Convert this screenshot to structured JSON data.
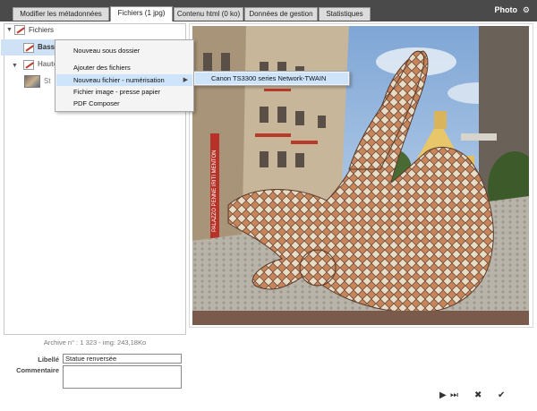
{
  "tabs": [
    {
      "label": "Modifier les métadonnées",
      "active": false
    },
    {
      "label": "Fichiers (1 jpg)",
      "active": true
    },
    {
      "label": "Contenu html (0 ko)",
      "active": false
    },
    {
      "label": "Données de gestion",
      "active": false
    },
    {
      "label": "Statistiques",
      "active": false
    }
  ],
  "header": {
    "title": "Photo",
    "gear_icon": "gear-icon"
  },
  "tree": {
    "root_label": "Fichiers",
    "items": [
      {
        "label": "Bass",
        "expanded": false,
        "selected": true
      },
      {
        "label": "Haute",
        "expanded": true
      },
      {
        "label": "St"
      }
    ]
  },
  "context_menu": {
    "items": [
      {
        "label": "Nouveau sous dossier"
      },
      {
        "label": "Ajouter des fichiers"
      },
      {
        "label": "Nouveau fichier - numérisation",
        "highlighted": true,
        "has_submenu": true
      },
      {
        "label": "Fichier image - presse papier"
      },
      {
        "label": "PDF Composer"
      }
    ],
    "submenu": {
      "items": [
        {
          "label": "Canon TS3300 series Network-TWAIN",
          "highlighted": true
        }
      ]
    }
  },
  "details": {
    "archive_info": "Archive n° : 1 323 - img: 243,18Ko",
    "libelle_label": "Libellé",
    "libelle_value": "Statue renversée",
    "commentaire_label": "Commentaire",
    "commentaire_value": ""
  },
  "toolbar": {
    "play_icon": "play-icon",
    "last_icon": "skip-last-icon",
    "cancel_icon": "close-icon",
    "validate_icon": "check-icon"
  },
  "photo_banner_text": "PALAZZO PENNE IRITI MENTON",
  "colors": {
    "topbar": "#4a4a4a",
    "selection": "#cfe2f5",
    "menu_highlight": "#cde4fb"
  }
}
